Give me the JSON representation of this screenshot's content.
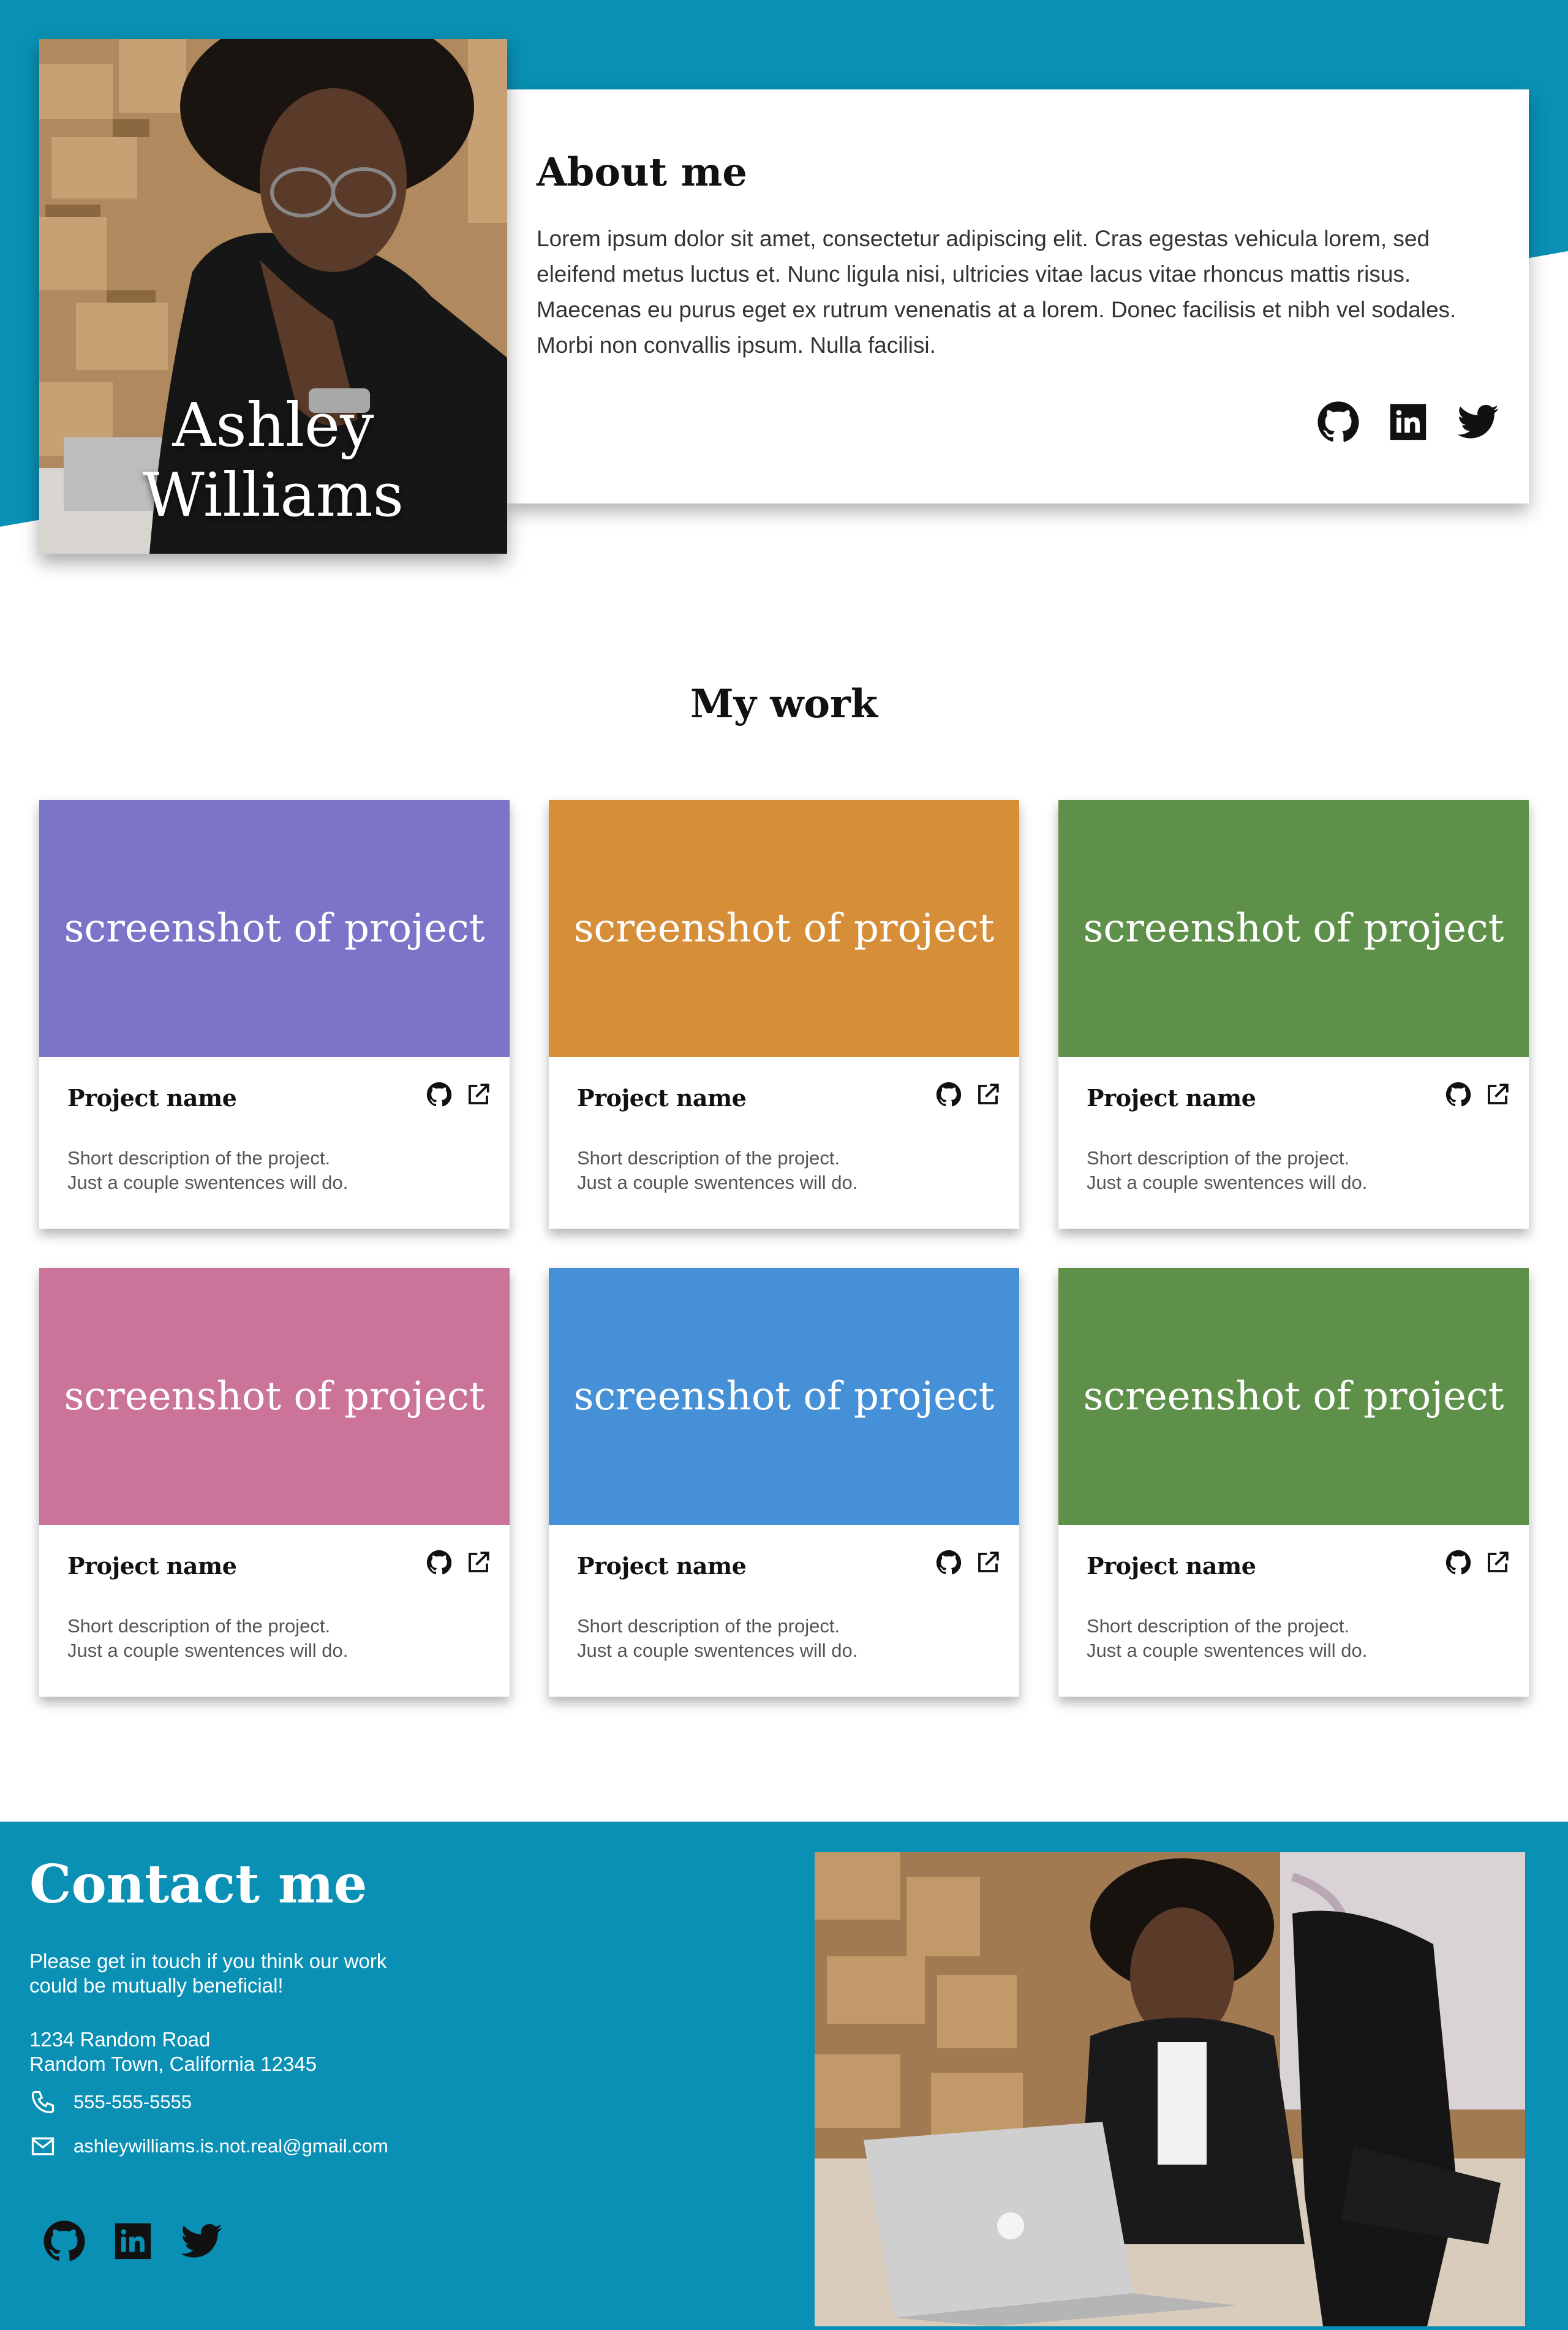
{
  "colors": {
    "brand_teal": "#0990b4",
    "project_colors": [
      "#7c74c8",
      "#d78e39",
      "#5e9049",
      "#cb7399",
      "#4690d7",
      "#5e9049"
    ]
  },
  "hero": {
    "name": "Ashley Williams",
    "about_title": "About me",
    "about_text": "Lorem ipsum dolor sit amet, consectetur adipiscing elit. Cras egestas vehicula lorem, sed eleifend metus luctus et. Nunc ligula nisi, ultricies vitae lacus vitae rhoncus mattis risus. Maecenas eu purus eget ex rutrum venenatis at a lorem. Donec facilisis et nibh vel sodales. Morbi non convallis ipsum. Nulla facilisi.",
    "social_icons": [
      "github-icon",
      "linkedin-icon",
      "twitter-icon"
    ]
  },
  "work": {
    "title": "My work",
    "projects": [
      {
        "shot_label": "screenshot of project",
        "name": "Project name",
        "desc_line1": "Short description of the project.",
        "desc_line2": "Just a couple swentences will do."
      },
      {
        "shot_label": "screenshot of project",
        "name": "Project name",
        "desc_line1": "Short description of the project.",
        "desc_line2": "Just a couple swentences will do."
      },
      {
        "shot_label": "screenshot of project",
        "name": "Project name",
        "desc_line1": "Short description of the project.",
        "desc_line2": "Just a couple swentences will do."
      },
      {
        "shot_label": "screenshot of project",
        "name": "Project name",
        "desc_line1": "Short description of the project.",
        "desc_line2": "Just a couple swentences will do."
      },
      {
        "shot_label": "screenshot of project",
        "name": "Project name",
        "desc_line1": "Short description of the project.",
        "desc_line2": "Just a couple swentences will do."
      },
      {
        "shot_label": "screenshot of project",
        "name": "Project name",
        "desc_line1": "Short description of the project.",
        "desc_line2": "Just a couple swentences will do."
      }
    ]
  },
  "contact": {
    "title": "Contact me",
    "message_line1": "Please get in touch if you think our work",
    "message_line2": "could be mutually beneficial!",
    "address_line1": "1234 Random Road",
    "address_line2": "Random Town, California 12345",
    "phone": "555-555-5555",
    "email": "ashleywilliams.is.not.real@gmail.com"
  }
}
